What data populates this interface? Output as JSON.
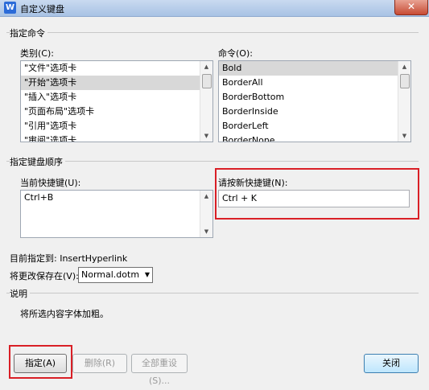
{
  "window": {
    "title": "自定义键盘",
    "close_glyph": "✕"
  },
  "specify_command": {
    "group_label": "指定命令",
    "categories_label": "类别(C):",
    "categories": [
      "\"文件\"选项卡",
      "\"开始\"选项卡",
      "\"插入\"选项卡",
      "\"页面布局\"选项卡",
      "\"引用\"选项卡",
      "\"审阅\"选项卡"
    ],
    "categories_selected": 1,
    "commands_label": "命令(O):",
    "commands": [
      "Bold",
      "BorderAll",
      "BorderBottom",
      "BorderInside",
      "BorderLeft",
      "BorderNone"
    ],
    "commands_selected": 0
  },
  "key_sequence": {
    "group_label": "指定键盘顺序",
    "current_keys_label": "当前快捷键(U):",
    "current_keys": [
      "Ctrl+B"
    ],
    "new_key_label": "请按新快捷键(N):",
    "new_key_value": "Ctrl + K"
  },
  "assigned_to": "目前指定到: InsertHyperlink",
  "save_in": {
    "label": "将更改保存在(V):",
    "value": "Normal.dotm"
  },
  "description": {
    "group_label": "说明",
    "text": "将所选内容字体加粗。"
  },
  "buttons": {
    "assign": "指定(A)",
    "remove": "删除(R)",
    "reset_all": "全部重设(S)...",
    "close": "关闭"
  },
  "colors": {
    "highlight": "#d91f26"
  }
}
